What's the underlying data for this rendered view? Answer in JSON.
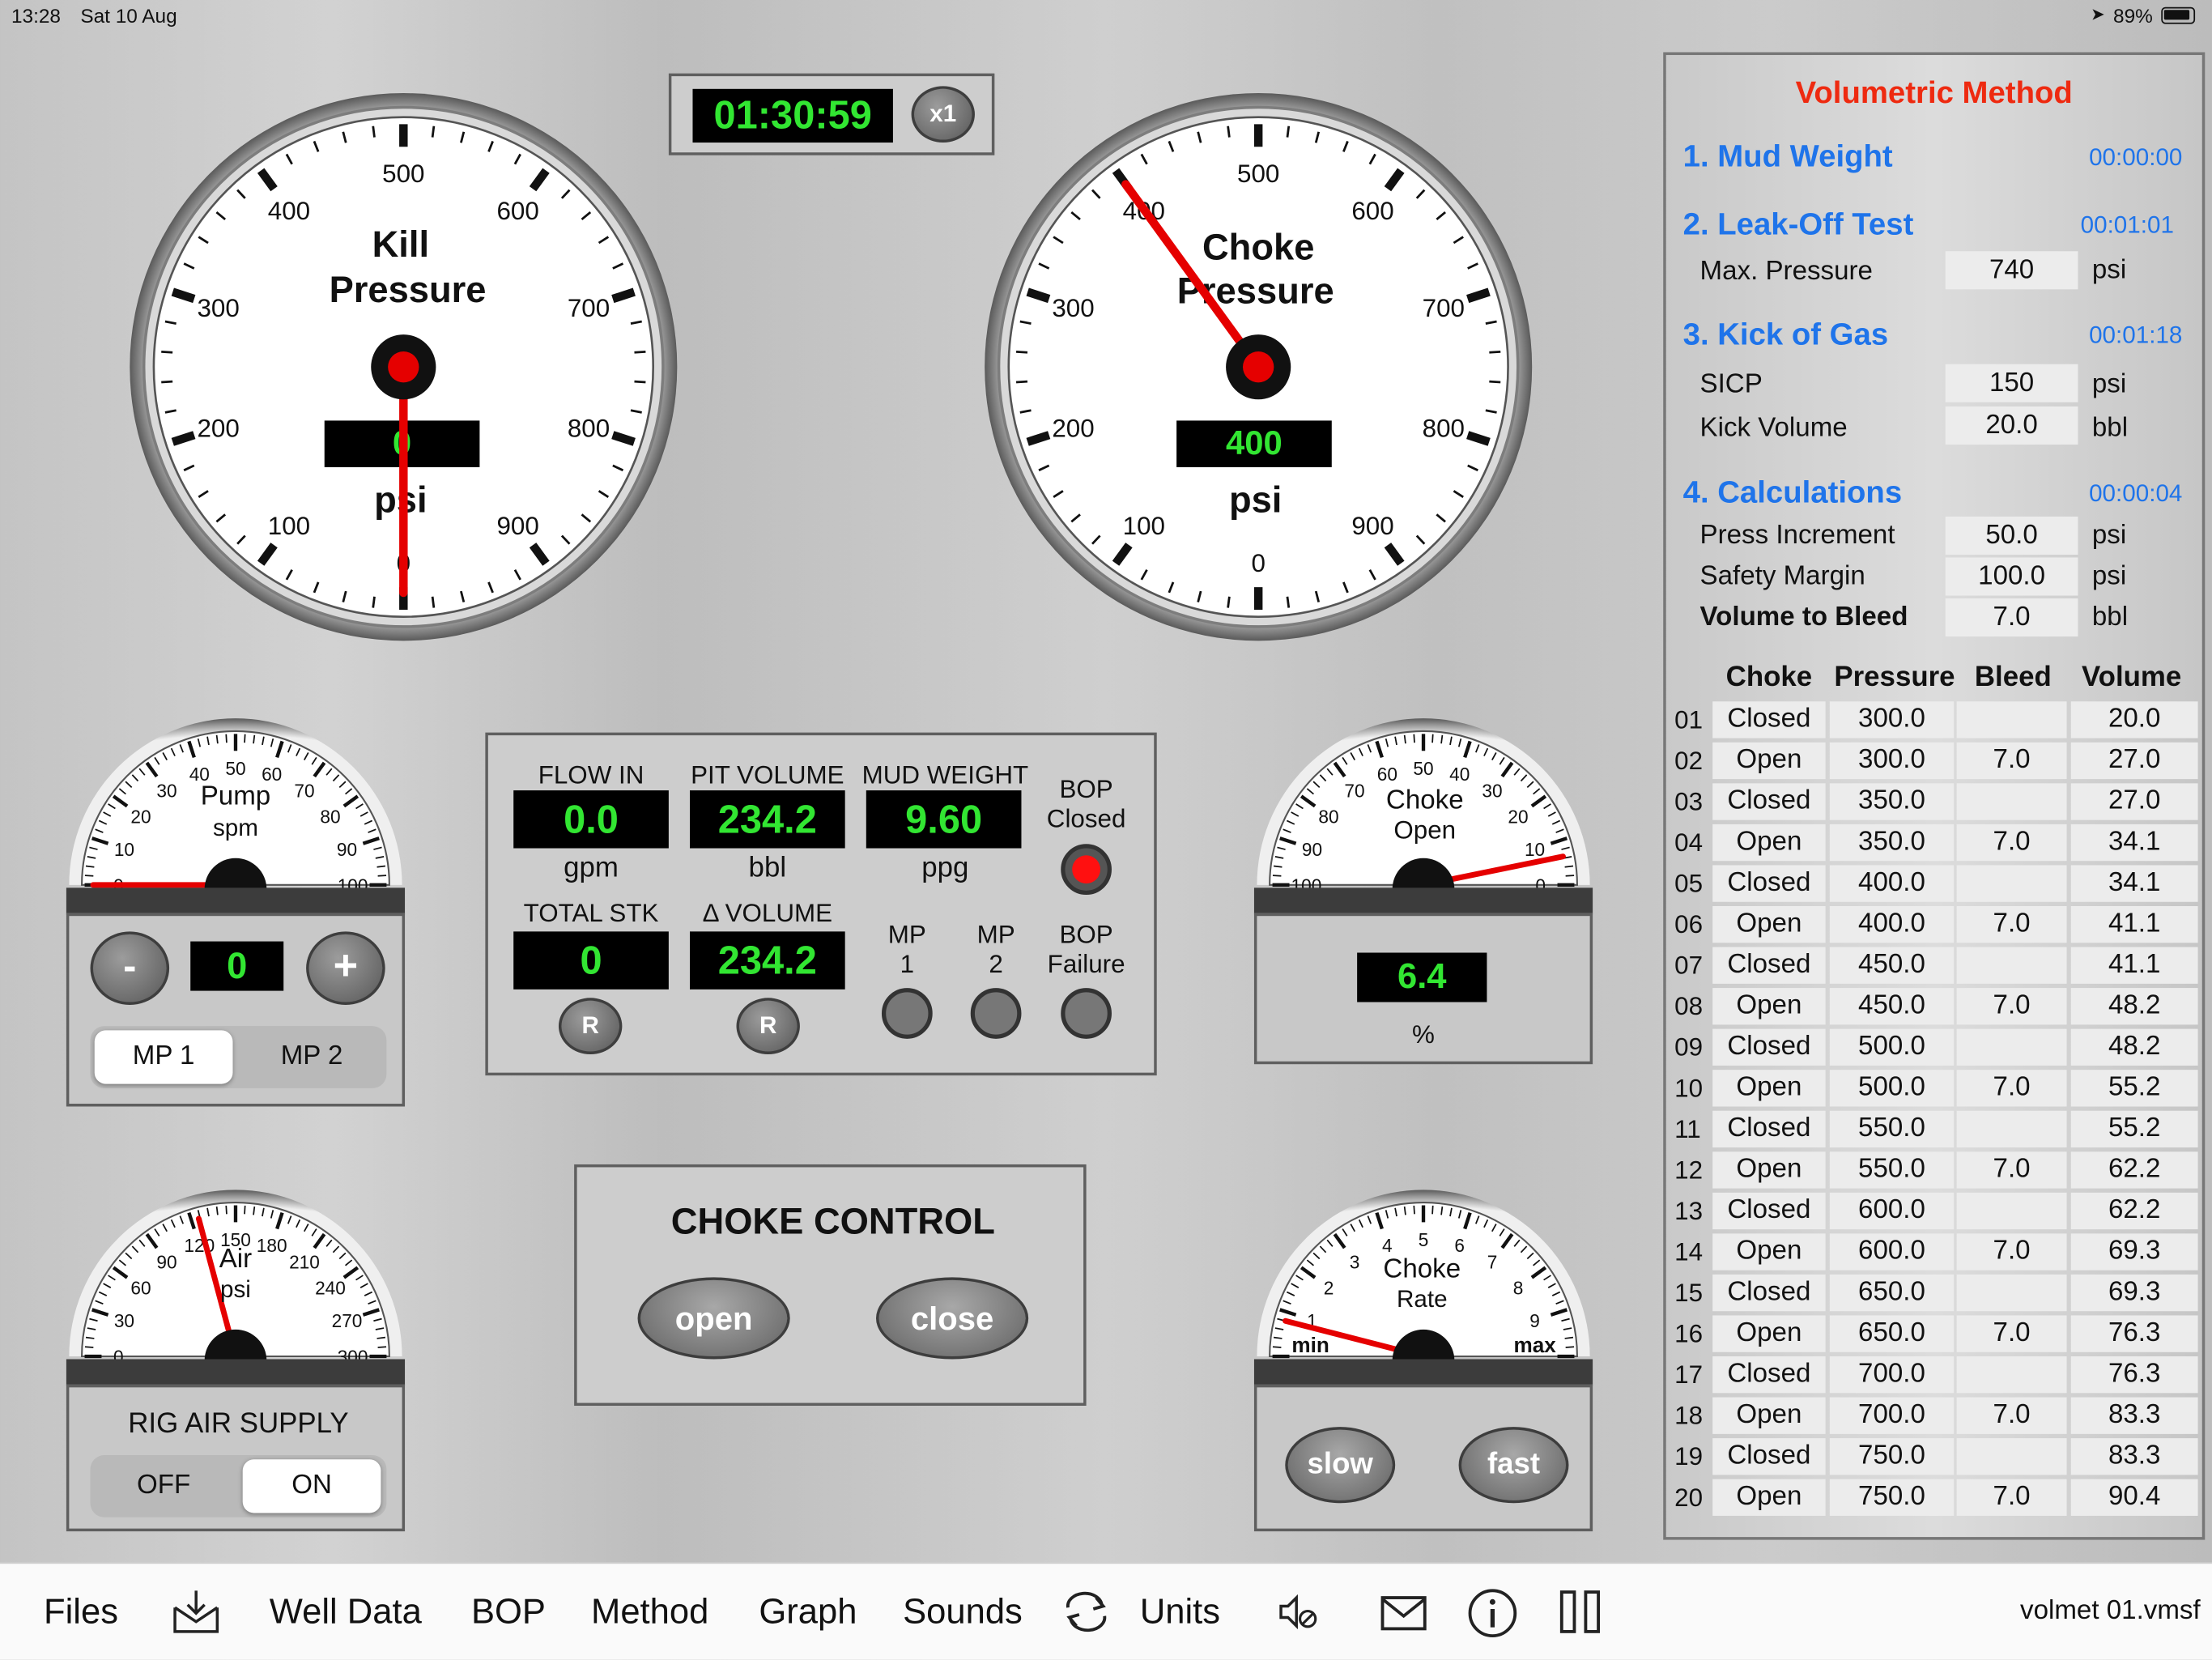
{
  "status_bar": {
    "time": "13:28",
    "date": "Sat 10 Aug",
    "battery": "89%"
  },
  "timer": {
    "value": "01:30:59",
    "speed": "x1"
  },
  "kill_gauge": {
    "title_line1": "Kill",
    "title_line2": "Pressure",
    "unit": "psi",
    "readout": "0",
    "value": 0,
    "ticks": [
      "0",
      "100",
      "200",
      "300",
      "400",
      "500",
      "600",
      "700",
      "800",
      "900"
    ]
  },
  "choke_gauge": {
    "title_line1": "Choke",
    "title_line2": "Pressure",
    "unit": "psi",
    "readout": "400",
    "value": 400,
    "ticks": [
      "0",
      "100",
      "200",
      "300",
      "400",
      "500",
      "600",
      "700",
      "800",
      "900"
    ]
  },
  "pump": {
    "title": "Pump",
    "unit": "spm",
    "value": 0,
    "readout": "0",
    "minus": "-",
    "plus": "+",
    "ticks": [
      "0",
      "10",
      "20",
      "30",
      "40",
      "50",
      "60",
      "70",
      "80",
      "90",
      "100"
    ],
    "selector": {
      "options": [
        "MP 1",
        "MP 2"
      ],
      "selected": "MP 1"
    }
  },
  "air": {
    "title": "Air",
    "unit": "psi",
    "value": 125,
    "ticks": [
      "0",
      "30",
      "60",
      "90",
      "120",
      "150",
      "180",
      "210",
      "240",
      "270",
      "300"
    ],
    "supply_label": "RIG AIR SUPPLY",
    "toggle": {
      "options": [
        "OFF",
        "ON"
      ],
      "selected": "ON"
    }
  },
  "choke_open": {
    "title": "Choke",
    "subtitle": "Open",
    "value_percent": 6.4,
    "readout": "6.4",
    "unit": "%",
    "ticks": [
      "100",
      "90",
      "80",
      "70",
      "60",
      "50",
      "40",
      "30",
      "20",
      "10",
      "0"
    ]
  },
  "choke_rate": {
    "title": "Choke",
    "subtitle": "Rate",
    "min_label": "min",
    "max_label": "max",
    "ticks": [
      "1",
      "2",
      "3",
      "4",
      "5",
      "6",
      "7",
      "8",
      "9"
    ],
    "value_fraction": 0.08,
    "slow": "slow",
    "fast": "fast"
  },
  "flow_panel": {
    "flow_in": {
      "label": "FLOW IN",
      "value": "0.0",
      "unit": "gpm"
    },
    "pit_volume": {
      "label": "PIT VOLUME",
      "value": "234.2",
      "unit": "bbl"
    },
    "mud_weight": {
      "label": "MUD WEIGHT",
      "value": "9.60",
      "unit": "ppg"
    },
    "bop_closed": {
      "line1": "BOP",
      "line2": "Closed",
      "color": "#ff1010"
    },
    "total_stk": {
      "label": "TOTAL STK",
      "value": "0",
      "reset": "R"
    },
    "delta_volume": {
      "label": "Δ VOLUME",
      "value": "234.2",
      "reset": "R"
    },
    "mp1": {
      "line1": "MP",
      "line2": "1"
    },
    "mp2": {
      "line1": "MP",
      "line2": "2"
    },
    "bop_failure": {
      "line1": "BOP",
      "line2": "Failure"
    }
  },
  "choke_control": {
    "title": "CHOKE CONTROL",
    "open": "open",
    "close": "close"
  },
  "method": {
    "title": "Volumetric Method",
    "sections": {
      "mud_weight": {
        "title": "1. Mud Weight",
        "time": "00:00:00"
      },
      "leak_off": {
        "title": "2. Leak-Off Test",
        "time": "00:01:01",
        "max_pressure_label": "Max. Pressure",
        "max_pressure": "740",
        "unit": "psi"
      },
      "kick": {
        "title": "3. Kick of Gas",
        "time": "00:01:18",
        "sicp_label": "SICP",
        "sicp": "150",
        "sicp_unit": "psi",
        "kick_volume_label": "Kick Volume",
        "kick_volume": "20.0",
        "kick_volume_unit": "bbl"
      },
      "calc": {
        "title": "4. Calculations",
        "time": "00:00:04",
        "press_inc_label": "Press Increment",
        "press_inc": "50.0",
        "press_inc_unit": "psi",
        "safety_label": "Safety Margin",
        "safety": "100.0",
        "safety_unit": "psi",
        "bleed_label": "Volume to Bleed",
        "bleed": "7.0",
        "bleed_unit": "bbl"
      }
    },
    "table": {
      "headers": [
        "Choke",
        "Pressure",
        "Bleed",
        "Volume"
      ],
      "rows": [
        [
          "01",
          "Closed",
          "300.0",
          "",
          "20.0"
        ],
        [
          "02",
          "Open",
          "300.0",
          "7.0",
          "27.0"
        ],
        [
          "03",
          "Closed",
          "350.0",
          "",
          "27.0"
        ],
        [
          "04",
          "Open",
          "350.0",
          "7.0",
          "34.1"
        ],
        [
          "05",
          "Closed",
          "400.0",
          "",
          "34.1"
        ],
        [
          "06",
          "Open",
          "400.0",
          "7.0",
          "41.1"
        ],
        [
          "07",
          "Closed",
          "450.0",
          "",
          "41.1"
        ],
        [
          "08",
          "Open",
          "450.0",
          "7.0",
          "48.2"
        ],
        [
          "09",
          "Closed",
          "500.0",
          "",
          "48.2"
        ],
        [
          "10",
          "Open",
          "500.0",
          "7.0",
          "55.2"
        ],
        [
          "11",
          "Closed",
          "550.0",
          "",
          "55.2"
        ],
        [
          "12",
          "Open",
          "550.0",
          "7.0",
          "62.2"
        ],
        [
          "13",
          "Closed",
          "600.0",
          "",
          "62.2"
        ],
        [
          "14",
          "Open",
          "600.0",
          "7.0",
          "69.3"
        ],
        [
          "15",
          "Closed",
          "650.0",
          "",
          "69.3"
        ],
        [
          "16",
          "Open",
          "650.0",
          "7.0",
          "76.3"
        ],
        [
          "17",
          "Closed",
          "700.0",
          "",
          "76.3"
        ],
        [
          "18",
          "Open",
          "700.0",
          "7.0",
          "83.3"
        ],
        [
          "19",
          "Closed",
          "750.0",
          "",
          "83.3"
        ],
        [
          "20",
          "Open",
          "750.0",
          "7.0",
          "90.4"
        ]
      ]
    }
  },
  "toolbar": {
    "files": "Files",
    "well_data": "Well Data",
    "bop": "BOP",
    "method": "Method",
    "graph": "Graph",
    "sounds": "Sounds",
    "units": "Units",
    "filename": "volmet 01.vmsf"
  }
}
